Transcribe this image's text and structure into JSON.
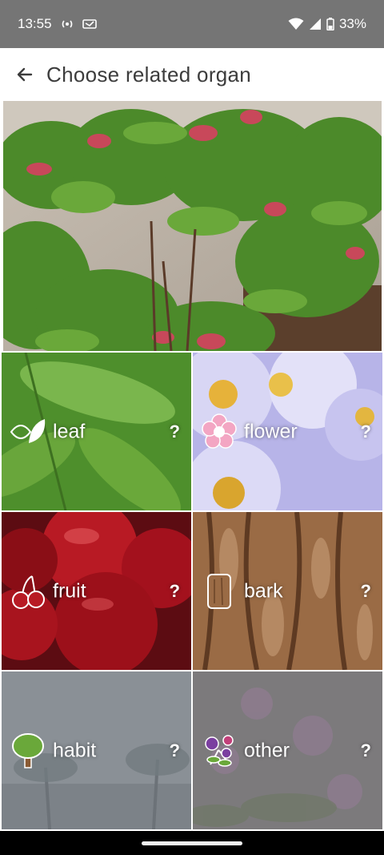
{
  "status_bar": {
    "time": "13:55",
    "battery_text": "33%",
    "icons": [
      "radio-icon",
      "card-icon",
      "wifi-icon",
      "signal-icon",
      "battery-icon"
    ]
  },
  "app_bar": {
    "title": "Choose related organ",
    "back_icon": "arrow-left-icon"
  },
  "hero_image": {
    "subject": "photinia shrub photo"
  },
  "organs": [
    {
      "label": "leaf",
      "help": "?",
      "icon": "leaf-icon",
      "color": "#4e8f2c"
    },
    {
      "label": "flower",
      "help": "?",
      "icon": "flower-icon",
      "color": "#b7b4e8"
    },
    {
      "label": "fruit",
      "help": "?",
      "icon": "cherry-icon",
      "color": "#a3111d"
    },
    {
      "label": "bark",
      "help": "?",
      "icon": "bark-icon",
      "color": "#9a6b45"
    },
    {
      "label": "habit",
      "help": "?",
      "icon": "tree-icon",
      "color": "#8a9096"
    },
    {
      "label": "other",
      "help": "?",
      "icon": "flowers-icon",
      "color": "#7c7a7c"
    }
  ]
}
